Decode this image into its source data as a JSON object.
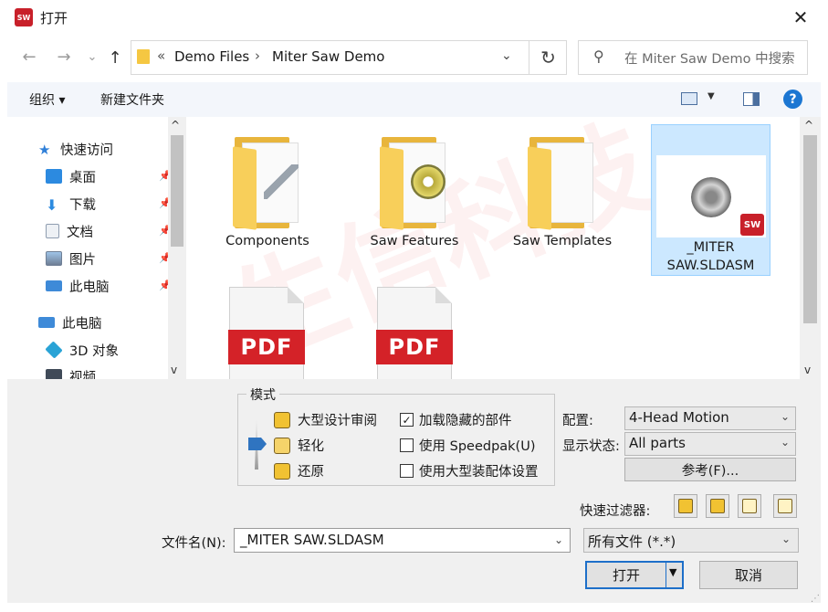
{
  "window": {
    "title": "打开",
    "app_icon_text": "SW",
    "close_glyph": "✕"
  },
  "nav_buttons": {
    "back": "←",
    "forward": "→",
    "recent": "⌄",
    "up": "↑"
  },
  "address": {
    "overflow": "«",
    "crumbs": [
      "Demo Files",
      "Miter Saw Demo"
    ],
    "separator": "›",
    "dropdown": "⌄",
    "refresh": "↻"
  },
  "search": {
    "placeholder": "在 Miter Saw Demo 中搜索",
    "icon": "search-icon"
  },
  "toolbar": {
    "organize": "组织 ▾",
    "new_folder": "新建文件夹",
    "view_dropdown": "▼",
    "help": "?"
  },
  "sidebar": {
    "items": [
      {
        "label": "快速访问",
        "icon": "star-icon",
        "color": "#2f7fd8"
      },
      {
        "label": "桌面",
        "icon": "desktop-icon",
        "color": "#2c8ae0",
        "pinned": true
      },
      {
        "label": "下载",
        "icon": "download-icon",
        "color": "#2c8ae0",
        "pinned": true
      },
      {
        "label": "文档",
        "icon": "document-icon",
        "color": "#8f9db0",
        "pinned": true
      },
      {
        "label": "图片",
        "icon": "picture-icon",
        "color": "#6f7f95",
        "pinned": true
      },
      {
        "label": "此电脑",
        "icon": "computer-icon",
        "color": "#3e8ad8",
        "pinned": true
      },
      {
        "label": "此电脑",
        "icon": "computer-icon",
        "color": "#3e8ad8"
      },
      {
        "label": "3D 对象",
        "icon": "cube-icon",
        "color": "#29a3d6"
      },
      {
        "label": "视频",
        "icon": "video-icon",
        "color": "#404a58"
      }
    ],
    "pin_glyph": "📌",
    "scroll_up": "^",
    "scroll_down": "v"
  },
  "files": {
    "items": [
      {
        "label": "Components",
        "type": "folder"
      },
      {
        "label": "Saw Features",
        "type": "folder"
      },
      {
        "label": "Saw Templates",
        "type": "folder"
      },
      {
        "label": "_MITER SAW.SLDASM",
        "type": "assembly",
        "selected": true
      },
      {
        "label": "PDF",
        "type": "pdf"
      },
      {
        "label": "PDF",
        "type": "pdf"
      }
    ],
    "badge": "SW",
    "scroll_up": "^",
    "scroll_down": "v"
  },
  "watermark": "生信科技",
  "mode": {
    "title": "模式",
    "options": [
      "大型设计审阅",
      "轻化",
      "还原"
    ],
    "selected": "轻化"
  },
  "checkboxes": [
    {
      "label": "加载隐藏的部件",
      "checked": true
    },
    {
      "label": "使用 Speedpak(U)",
      "checked": false
    },
    {
      "label": "使用大型装配体设置",
      "checked": false
    }
  ],
  "config": {
    "label": "配置:",
    "value": "4-Head Motion",
    "display_label": "显示状态:",
    "display_value": "All parts",
    "reference_button": "参考(F)..."
  },
  "quick_filter_label": "快速过滤器:",
  "filename": {
    "label": "文件名(N):",
    "value": "_MITER SAW.SLDASM",
    "filetype": "所有文件 (*.*)"
  },
  "buttons": {
    "open": "打开",
    "cancel": "取消",
    "open_arrow": "▼"
  },
  "chevron": "⌄",
  "check_glyph": "✓",
  "accent_color": "#1d6fc9"
}
